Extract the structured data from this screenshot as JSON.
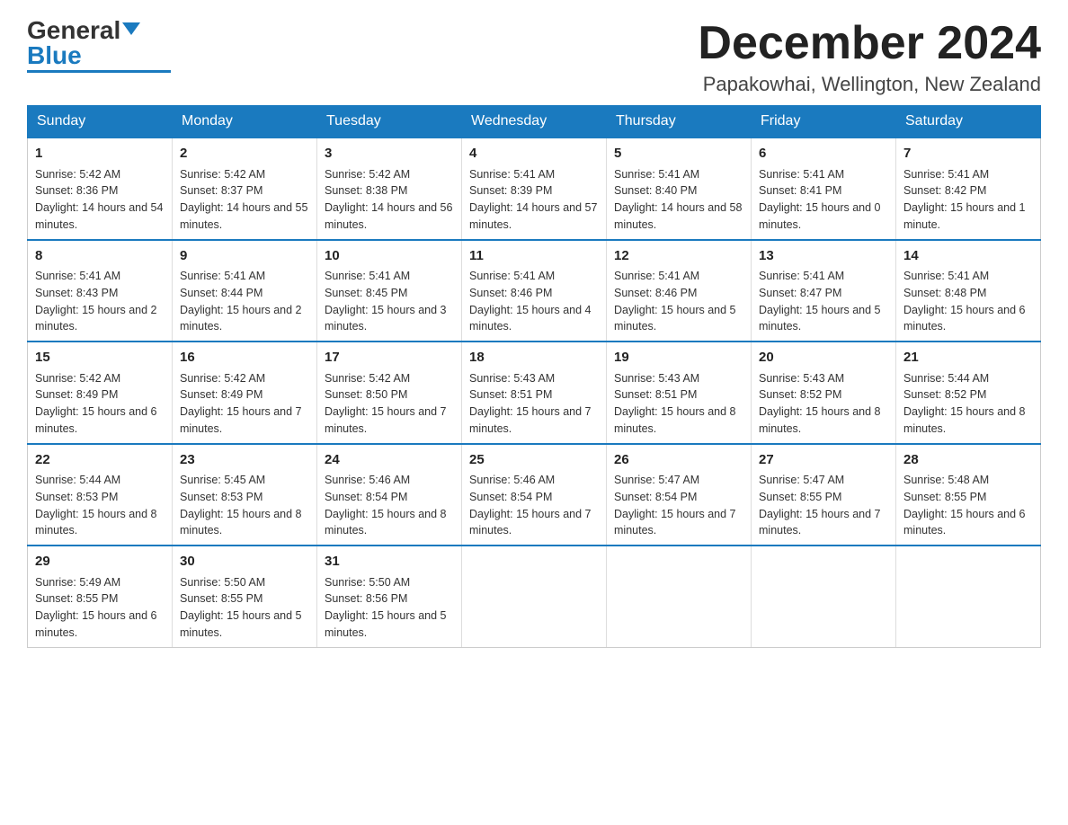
{
  "header": {
    "logo_general": "General",
    "logo_blue": "Blue",
    "month_title": "December 2024",
    "location": "Papakowhai, Wellington, New Zealand"
  },
  "days_of_week": [
    "Sunday",
    "Monday",
    "Tuesday",
    "Wednesday",
    "Thursday",
    "Friday",
    "Saturday"
  ],
  "weeks": [
    [
      {
        "day": "1",
        "sunrise": "5:42 AM",
        "sunset": "8:36 PM",
        "daylight": "14 hours and 54 minutes."
      },
      {
        "day": "2",
        "sunrise": "5:42 AM",
        "sunset": "8:37 PM",
        "daylight": "14 hours and 55 minutes."
      },
      {
        "day": "3",
        "sunrise": "5:42 AM",
        "sunset": "8:38 PM",
        "daylight": "14 hours and 56 minutes."
      },
      {
        "day": "4",
        "sunrise": "5:41 AM",
        "sunset": "8:39 PM",
        "daylight": "14 hours and 57 minutes."
      },
      {
        "day": "5",
        "sunrise": "5:41 AM",
        "sunset": "8:40 PM",
        "daylight": "14 hours and 58 minutes."
      },
      {
        "day": "6",
        "sunrise": "5:41 AM",
        "sunset": "8:41 PM",
        "daylight": "15 hours and 0 minutes."
      },
      {
        "day": "7",
        "sunrise": "5:41 AM",
        "sunset": "8:42 PM",
        "daylight": "15 hours and 1 minute."
      }
    ],
    [
      {
        "day": "8",
        "sunrise": "5:41 AM",
        "sunset": "8:43 PM",
        "daylight": "15 hours and 2 minutes."
      },
      {
        "day": "9",
        "sunrise": "5:41 AM",
        "sunset": "8:44 PM",
        "daylight": "15 hours and 2 minutes."
      },
      {
        "day": "10",
        "sunrise": "5:41 AM",
        "sunset": "8:45 PM",
        "daylight": "15 hours and 3 minutes."
      },
      {
        "day": "11",
        "sunrise": "5:41 AM",
        "sunset": "8:46 PM",
        "daylight": "15 hours and 4 minutes."
      },
      {
        "day": "12",
        "sunrise": "5:41 AM",
        "sunset": "8:46 PM",
        "daylight": "15 hours and 5 minutes."
      },
      {
        "day": "13",
        "sunrise": "5:41 AM",
        "sunset": "8:47 PM",
        "daylight": "15 hours and 5 minutes."
      },
      {
        "day": "14",
        "sunrise": "5:41 AM",
        "sunset": "8:48 PM",
        "daylight": "15 hours and 6 minutes."
      }
    ],
    [
      {
        "day": "15",
        "sunrise": "5:42 AM",
        "sunset": "8:49 PM",
        "daylight": "15 hours and 6 minutes."
      },
      {
        "day": "16",
        "sunrise": "5:42 AM",
        "sunset": "8:49 PM",
        "daylight": "15 hours and 7 minutes."
      },
      {
        "day": "17",
        "sunrise": "5:42 AM",
        "sunset": "8:50 PM",
        "daylight": "15 hours and 7 minutes."
      },
      {
        "day": "18",
        "sunrise": "5:43 AM",
        "sunset": "8:51 PM",
        "daylight": "15 hours and 7 minutes."
      },
      {
        "day": "19",
        "sunrise": "5:43 AM",
        "sunset": "8:51 PM",
        "daylight": "15 hours and 8 minutes."
      },
      {
        "day": "20",
        "sunrise": "5:43 AM",
        "sunset": "8:52 PM",
        "daylight": "15 hours and 8 minutes."
      },
      {
        "day": "21",
        "sunrise": "5:44 AM",
        "sunset": "8:52 PM",
        "daylight": "15 hours and 8 minutes."
      }
    ],
    [
      {
        "day": "22",
        "sunrise": "5:44 AM",
        "sunset": "8:53 PM",
        "daylight": "15 hours and 8 minutes."
      },
      {
        "day": "23",
        "sunrise": "5:45 AM",
        "sunset": "8:53 PM",
        "daylight": "15 hours and 8 minutes."
      },
      {
        "day": "24",
        "sunrise": "5:46 AM",
        "sunset": "8:54 PM",
        "daylight": "15 hours and 8 minutes."
      },
      {
        "day": "25",
        "sunrise": "5:46 AM",
        "sunset": "8:54 PM",
        "daylight": "15 hours and 7 minutes."
      },
      {
        "day": "26",
        "sunrise": "5:47 AM",
        "sunset": "8:54 PM",
        "daylight": "15 hours and 7 minutes."
      },
      {
        "day": "27",
        "sunrise": "5:47 AM",
        "sunset": "8:55 PM",
        "daylight": "15 hours and 7 minutes."
      },
      {
        "day": "28",
        "sunrise": "5:48 AM",
        "sunset": "8:55 PM",
        "daylight": "15 hours and 6 minutes."
      }
    ],
    [
      {
        "day": "29",
        "sunrise": "5:49 AM",
        "sunset": "8:55 PM",
        "daylight": "15 hours and 6 minutes."
      },
      {
        "day": "30",
        "sunrise": "5:50 AM",
        "sunset": "8:55 PM",
        "daylight": "15 hours and 5 minutes."
      },
      {
        "day": "31",
        "sunrise": "5:50 AM",
        "sunset": "8:56 PM",
        "daylight": "15 hours and 5 minutes."
      },
      null,
      null,
      null,
      null
    ]
  ],
  "labels": {
    "sunrise": "Sunrise:",
    "sunset": "Sunset:",
    "daylight": "Daylight:"
  }
}
